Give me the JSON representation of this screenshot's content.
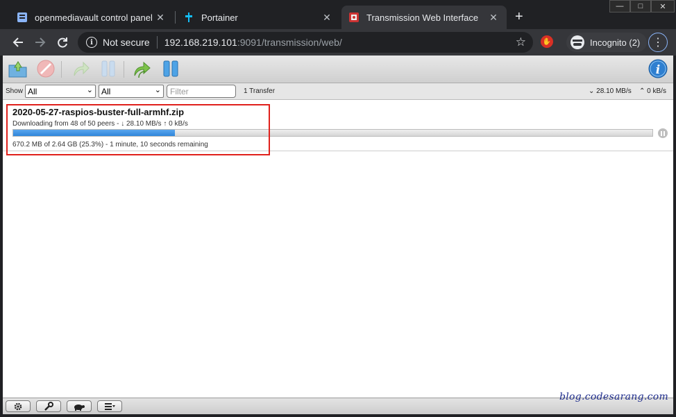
{
  "browser": {
    "tabs": [
      {
        "title": "openmediavault control panel - H",
        "active": false
      },
      {
        "title": "Portainer",
        "active": false
      },
      {
        "title": "Transmission Web Interface",
        "active": true
      }
    ],
    "close_glyph": "✕",
    "new_tab": "+",
    "window_controls": {
      "minimize": "—",
      "maximize": "□",
      "close": "✕"
    },
    "omnibox": {
      "security": "Not secure",
      "host": "192.168.219.101",
      "path": ":9091/transmission/web/"
    },
    "profile": {
      "label": "Incognito (2)"
    },
    "accent": "#8ab4f8"
  },
  "toolbar": {
    "icons": [
      "open-torrent-icon",
      "remove-torrent-icon",
      "resume-icon",
      "pause-icon",
      "resume-all-icon",
      "pause-all-icon",
      "info-icon"
    ]
  },
  "filterbar": {
    "show_label": "Show",
    "status_value": "All",
    "tracker_value": "All",
    "filter_placeholder": "Filter",
    "transfer_count": "1 Transfer",
    "download_speed": "28.10 MB/s",
    "upload_speed": "0 kB/s"
  },
  "torrent": {
    "name": "2020-05-27-raspios-buster-full-armhf.zip",
    "peers": "Downloading from 48 of 50 peers - ↓ 28.10 MB/s ↑ 0 kB/s",
    "progress_text": "670.2 MB of 2.64 GB (25.3%) - 1 minute, 10 seconds remaining",
    "progress_fraction": 0.253
  },
  "bottombar": {
    "icons": [
      "gear-icon",
      "wrench-icon",
      "turtle-icon",
      "sort-icon"
    ]
  },
  "watermark": "blog.codesarang.com"
}
